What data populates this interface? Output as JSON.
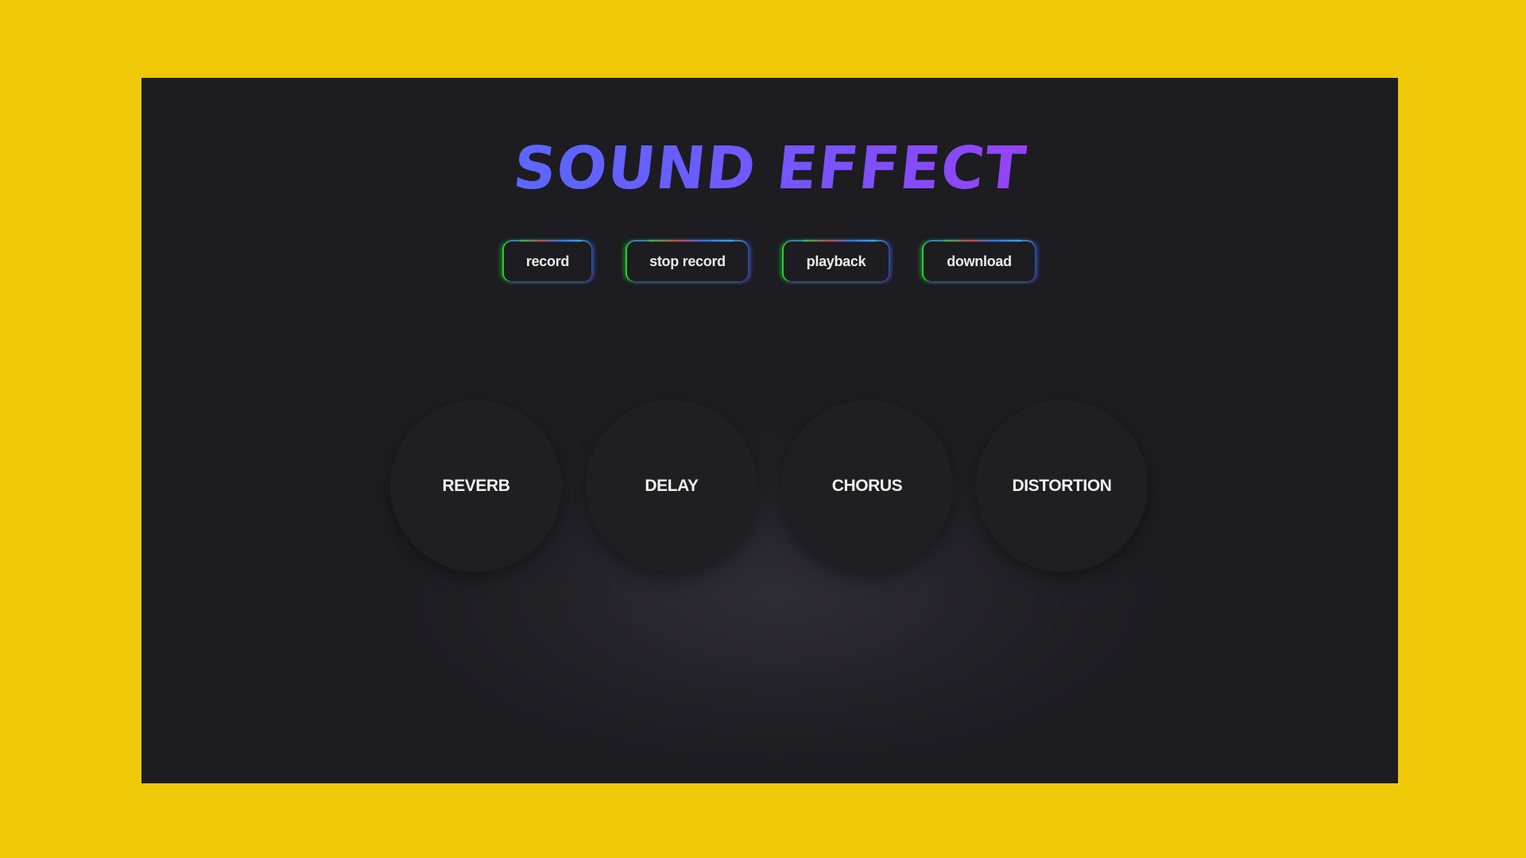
{
  "app": {
    "title": "SOUND EFFECT"
  },
  "controls": {
    "record_label": "record",
    "stop_record_label": "stop record",
    "playback_label": "playback",
    "download_label": "download"
  },
  "effects": [
    {
      "label": "REVERB"
    },
    {
      "label": "DELAY"
    },
    {
      "label": "CHORUS"
    },
    {
      "label": "DISTORTION"
    }
  ],
  "colors": {
    "page_background": "#efc908",
    "panel_background": "#1d1c21",
    "title_gradient_start": "#3f7bff",
    "title_gradient_end": "#c235e8",
    "button_glow_green": "#1fd12c",
    "button_glow_blue": "#3a6bff"
  }
}
